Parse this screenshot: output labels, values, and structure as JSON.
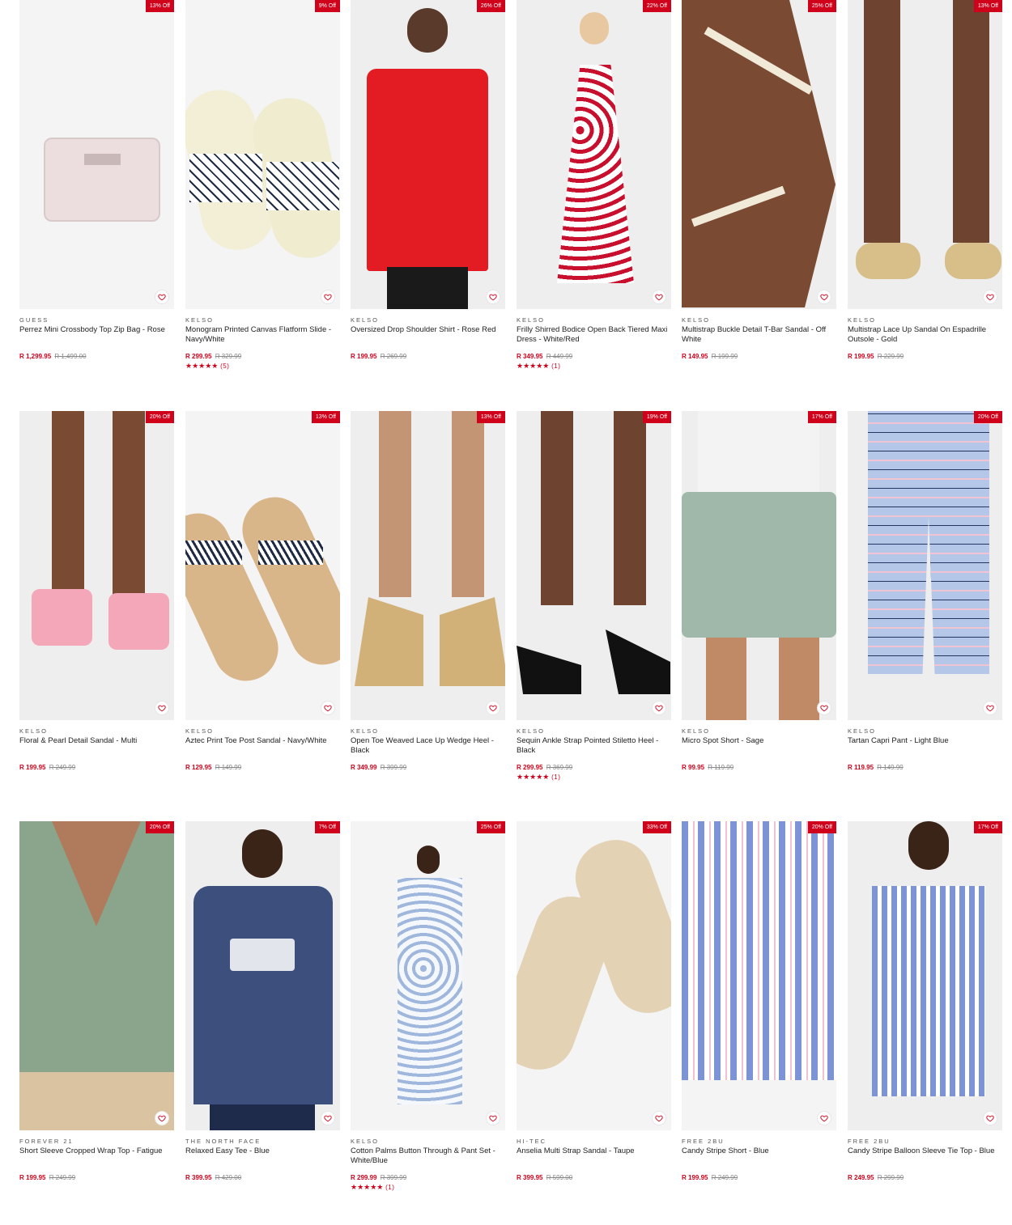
{
  "colors": {
    "accent": "#d0021b",
    "text": "#222222",
    "muted": "#888888"
  },
  "icons": {
    "wishlist": "heart-outline-icon",
    "rating": "star-icon"
  },
  "products": [
    {
      "badge": "13% Off",
      "brand": "GUESS",
      "name": "Perrez Mini Crossbody Top Zip Bag - Rose",
      "price": "R 1,299.95",
      "was": "R 1,499.00",
      "stars": "",
      "reviews": "",
      "image": "crossbody bag"
    },
    {
      "badge": "9% Off",
      "brand": "KELSO",
      "name": "Monogram Printed Canvas Flatform Slide - Navy/White",
      "price": "R 299.95",
      "was": "R 329.99",
      "stars": "★★★★★",
      "reviews": "(5)",
      "image": "slide sandals"
    },
    {
      "badge": "26% Off",
      "brand": "KELSO",
      "name": "Oversized Drop Shoulder Shirt - Rose Red",
      "price": "R 199.95",
      "was": "R 269.99",
      "stars": "",
      "reviews": "",
      "image": "red shirt"
    },
    {
      "badge": "22% Off",
      "brand": "KELSO",
      "name": "Frilly Shirred Bodice Open Back Tiered Maxi Dress - White/Red",
      "price": "R 349.95",
      "was": "R 449.99",
      "stars": "★★★★★",
      "reviews": "(1)",
      "image": "maxi dress"
    },
    {
      "badge": "25% Off",
      "brand": "KELSO",
      "name": "Multistrap Buckle Detail T-Bar Sandal - Off White",
      "price": "R 149.95",
      "was": "R 199.99",
      "stars": "",
      "reviews": "",
      "image": "t-bar sandal"
    },
    {
      "badge": "13% Off",
      "brand": "KELSO",
      "name": "Multistrap Lace Up Sandal On Espadrille Outsole - Gold",
      "price": "R 199.95",
      "was": "R 229.99",
      "stars": "",
      "reviews": "",
      "image": "lace up sandal"
    },
    {
      "badge": "20% Off",
      "brand": "KELSO",
      "name": "Floral & Pearl Detail Sandal - Multi",
      "price": "R 199.95",
      "was": "R 249.99",
      "stars": "",
      "reviews": "",
      "image": "floral sandal"
    },
    {
      "badge": "13% Off",
      "brand": "KELSO",
      "name": "Aztec Print Toe Post Sandal - Navy/White",
      "price": "R 129.95",
      "was": "R 149.99",
      "stars": "",
      "reviews": "",
      "image": "toe post sandal"
    },
    {
      "badge": "13% Off",
      "brand": "KELSO",
      "name": "Open Toe Weaved Lace Up Wedge Heel - Black",
      "price": "R 349.99",
      "was": "R 399.99",
      "stars": "",
      "reviews": "",
      "image": "wedge heel"
    },
    {
      "badge": "19% Off",
      "brand": "KELSO",
      "name": "Sequin Ankle Strap Pointed Stiletto Heel - Black",
      "price": "R 299.95",
      "was": "R 369.99",
      "stars": "★★★★★",
      "reviews": "(1)",
      "image": "stiletto heel"
    },
    {
      "badge": "17% Off",
      "brand": "KELSO",
      "name": "Micro Spot Short - Sage",
      "price": "R 99.95",
      "was": "R 119.99",
      "stars": "",
      "reviews": "",
      "image": "sage short"
    },
    {
      "badge": "20% Off",
      "brand": "KELSO",
      "name": "Tartan Capri Pant - Light Blue",
      "price": "R 119.95",
      "was": "R 149.99",
      "stars": "",
      "reviews": "",
      "image": "tartan pant"
    },
    {
      "badge": "20% Off",
      "brand": "FOREVER 21",
      "name": "Short Sleeve Cropped Wrap Top - Fatigue",
      "price": "R 199.95",
      "was": "R 249.99",
      "stars": "",
      "reviews": "",
      "image": "wrap top"
    },
    {
      "badge": "7% Off",
      "brand": "THE NORTH FACE",
      "name": "Relaxed Easy Tee - Blue",
      "price": "R 399.95",
      "was": "R 429.00",
      "stars": "",
      "reviews": "",
      "image": "navy tee"
    },
    {
      "badge": "25% Off",
      "brand": "KELSO",
      "name": "Cotton Palms Button Through & Pant Set - White/Blue",
      "price": "R 299.99",
      "was": "R 399.99",
      "stars": "★★★★★",
      "reviews": "(1)",
      "image": "pajama set"
    },
    {
      "badge": "33% Off",
      "brand": "HI-TEC",
      "name": "Anselia Multi Strap Sandal - Taupe",
      "price": "R 399.95",
      "was": "R 599.00",
      "stars": "",
      "reviews": "",
      "image": "sport sandal"
    },
    {
      "badge": "20% Off",
      "brand": "FREE 2BU",
      "name": "Candy Stripe Short - Blue",
      "price": "R 199.95",
      "was": "R 249.99",
      "stars": "",
      "reviews": "",
      "image": "stripe short"
    },
    {
      "badge": "17% Off",
      "brand": "FREE 2BU",
      "name": "Candy Stripe Balloon Sleeve Tie Top - Blue",
      "price": "R 249.95",
      "was": "R 299.99",
      "stars": "",
      "reviews": "",
      "image": "stripe top"
    }
  ]
}
